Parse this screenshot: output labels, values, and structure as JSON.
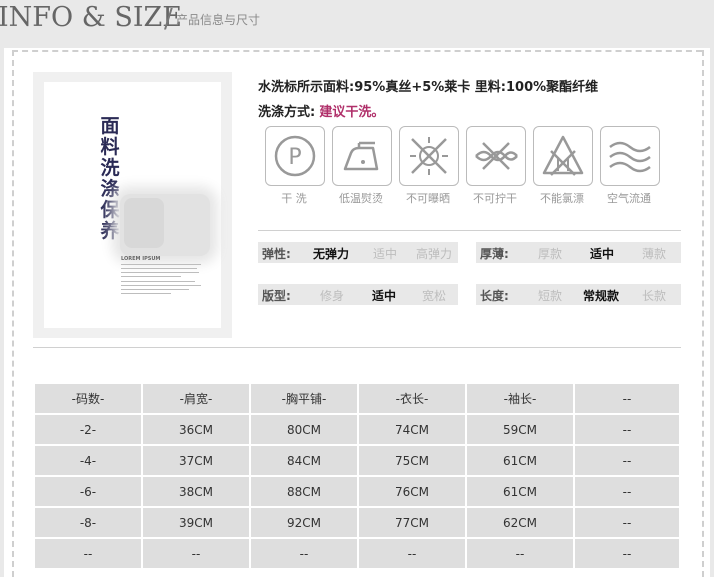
{
  "header": {
    "title_en": "INFO & SIZE",
    "slash": "/",
    "title_cn": "产品信息与尺寸"
  },
  "poster": {
    "title_chars": [
      "面",
      "料",
      "洗",
      "涤",
      "保",
      "养"
    ],
    "lorem_heading": "LOREM IPSUM"
  },
  "composition": "水洗标所示面料:95%真丝+5%莱卡  里料:100%聚酯纤维",
  "washing": {
    "label": "洗涤方式:",
    "value": "建议干洗。"
  },
  "care_icons": [
    {
      "icon": "dry-clean-p-icon",
      "label": "干 洗"
    },
    {
      "icon": "low-temp-iron-icon",
      "label": "低温熨烫"
    },
    {
      "icon": "no-sun-dry-icon",
      "label": "不可曝晒"
    },
    {
      "icon": "no-wring-icon",
      "label": "不可拧干"
    },
    {
      "icon": "no-bleach-icon",
      "label": "不能氯漂"
    },
    {
      "icon": "air-flow-icon",
      "label": "空气流通"
    }
  ],
  "attributes": {
    "elasticity": {
      "label": "弹性:",
      "options": [
        "无弹力",
        "适中",
        "高弹力"
      ],
      "selected": "无弹力"
    },
    "thickness": {
      "label": "厚薄:",
      "options": [
        "厚款",
        "适中",
        "薄款"
      ],
      "selected": "适中"
    },
    "fit": {
      "label": "版型:",
      "options": [
        "修身",
        "适中",
        "宽松"
      ],
      "selected": "适中"
    },
    "length": {
      "label": "长度:",
      "options": [
        "短款",
        "常规款",
        "长款"
      ],
      "selected": "常规款"
    }
  },
  "size_table": {
    "headers": [
      "-码数-",
      "-肩宽-",
      "-胸平铺-",
      "-衣长-",
      "-袖长-",
      "--"
    ],
    "rows": [
      [
        "-2-",
        "36CM",
        "80CM",
        "74CM",
        "59CM",
        "--"
      ],
      [
        "-4-",
        "37CM",
        "84CM",
        "75CM",
        "61CM",
        "--"
      ],
      [
        "-6-",
        "38CM",
        "88CM",
        "76CM",
        "61CM",
        "--"
      ],
      [
        "-8-",
        "39CM",
        "92CM",
        "77CM",
        "62CM",
        "--"
      ],
      [
        "--",
        "--",
        "--",
        "--",
        "--",
        "--"
      ]
    ]
  }
}
